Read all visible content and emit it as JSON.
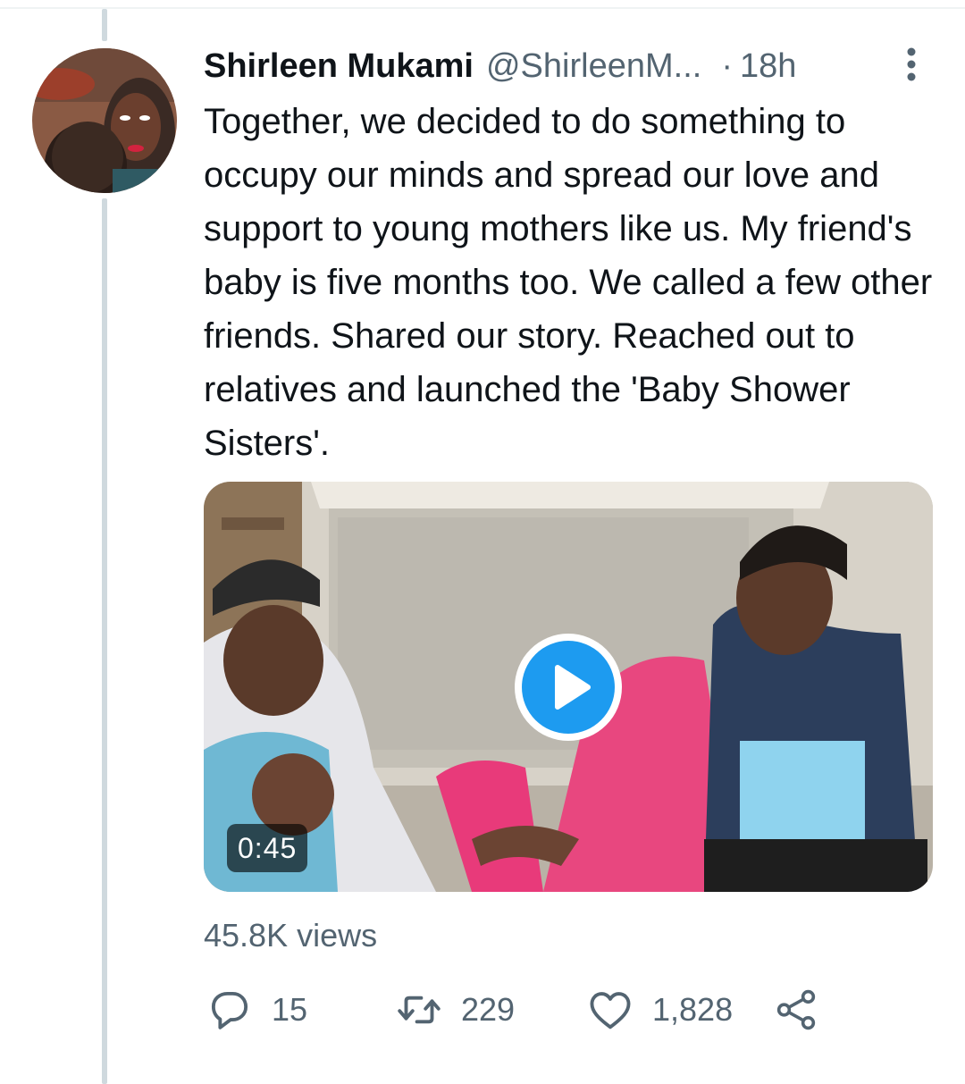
{
  "tweet": {
    "display_name": "Shirleen Mukami",
    "handle": "@ShirleenM...",
    "separator": "·",
    "time": "18h",
    "text": "Together, we decided to do something to occupy our minds and spread our love and support to young mothers like us. My friend's baby is five months too. We called a few other friends. Shared our story. Reached out to relatives and launched the 'Baby Shower Sisters'."
  },
  "media": {
    "type": "video",
    "duration": "0:45"
  },
  "stats": {
    "views": "45.8K views"
  },
  "actions": {
    "reply_count": "15",
    "retweet_count": "229",
    "like_count": "1,828"
  },
  "icons": {
    "more": "more-vertical-icon",
    "reply": "reply-icon",
    "retweet": "retweet-icon",
    "like": "heart-icon",
    "share": "share-icon",
    "play": "play-icon"
  },
  "colors": {
    "accent": "#1d9bf0",
    "secondary_text": "#536471",
    "primary_text": "#0f1419",
    "thread_line": "#cfd9de"
  }
}
